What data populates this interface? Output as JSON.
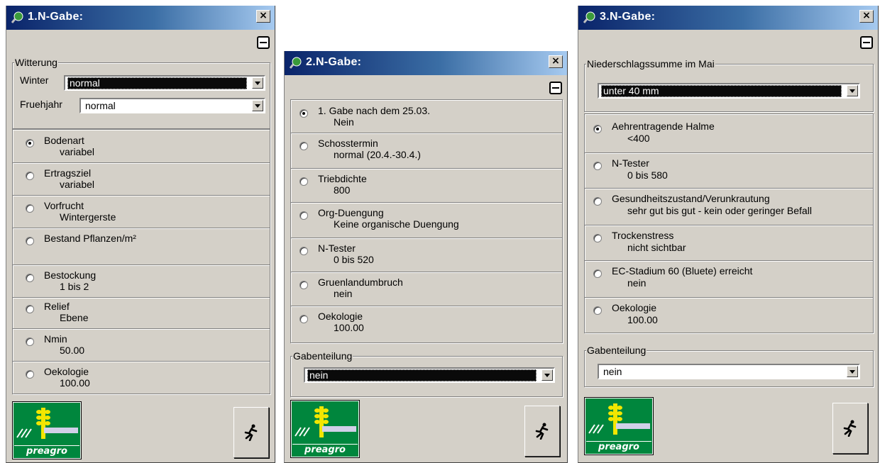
{
  "windows": [
    {
      "title": "1.N-Gabe:",
      "close": "×",
      "witterung": {
        "label": "Witterung",
        "rows": [
          {
            "label": "Winter",
            "value": "normal"
          },
          {
            "label": "Fruehjahr",
            "value": "normal"
          }
        ]
      },
      "items": [
        {
          "label": "Bodenart",
          "value": "variabel",
          "selected": true
        },
        {
          "label": "Ertragsziel",
          "value": "variabel"
        },
        {
          "label": "Vorfrucht",
          "value": "Wintergerste"
        },
        {
          "label": "Bestand Pflanzen/m²",
          "value": ""
        },
        {
          "label": "Bestockung",
          "value": "1 bis 2"
        },
        {
          "label": "Relief",
          "value": "Ebene"
        },
        {
          "label": "Nmin",
          "value": "50.00"
        },
        {
          "label": "Oekologie",
          "value": "100.00"
        }
      ],
      "logo": "preagro"
    },
    {
      "title": "2.N-Gabe:",
      "close": "×",
      "items": [
        {
          "label": "1. Gabe nach dem 25.03.",
          "value": "Nein",
          "selected": true
        },
        {
          "label": "Schosstermin",
          "value": "normal (20.4.-30.4.)"
        },
        {
          "label": "Triebdichte",
          "value": "800"
        },
        {
          "label": "Org-Duengung",
          "value": "Keine organische Duengung"
        },
        {
          "label": "N-Tester",
          "value": "0 bis 520"
        },
        {
          "label": "Gruenlandumbruch",
          "value": "nein"
        },
        {
          "label": "Oekologie",
          "value": "100.00"
        }
      ],
      "gabenteilung": {
        "label": "Gabenteilung",
        "value": "nein"
      },
      "logo": "preagro"
    },
    {
      "title": "3.N-Gabe:",
      "close": "×",
      "niederschlag": {
        "label": "Niederschlagssumme im Mai",
        "value": "unter 40 mm"
      },
      "items": [
        {
          "label": "Aehrentragende Halme",
          "value": "<400",
          "selected": true
        },
        {
          "label": "N-Tester",
          "value": "0 bis 580"
        },
        {
          "label": "Gesundheitszustand/Verunkrautung",
          "value": "sehr gut bis gut - kein oder geringer Befall"
        },
        {
          "label": "Trockenstress",
          "value": "nicht sichtbar"
        },
        {
          "label": "EC-Stadium 60 (Bluete) erreicht",
          "value": "nein"
        },
        {
          "label": "Oekologie",
          "value": "100.00"
        }
      ],
      "gabenteilung": {
        "label": "Gabenteilung",
        "value": "nein"
      },
      "logo": "preagro"
    }
  ],
  "icons": {
    "title": "magnifier-globe-icon",
    "run": "running-man-icon",
    "close": "close-icon",
    "minimize": "minimize-icon"
  }
}
